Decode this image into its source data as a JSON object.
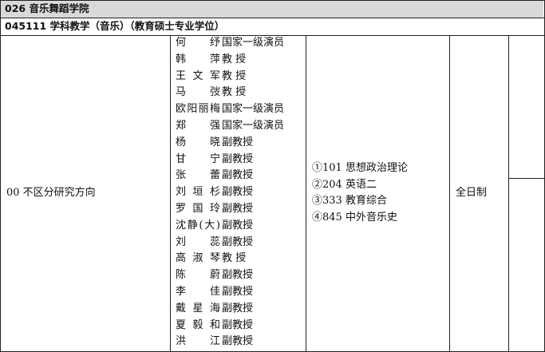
{
  "department": {
    "title": "026 音乐舞蹈学院"
  },
  "program": {
    "title": "045111 学科教学（音乐）（教育硕士专业学位）"
  },
  "row": {
    "direction": "00 不区分研究方向",
    "study_mode": "全日制",
    "teachers": [
      {
        "name": "何 纾",
        "title": "国家一级演员"
      },
      {
        "name": "韩 萍",
        "title": "教 授"
      },
      {
        "name": "王文军",
        "title": "教 授"
      },
      {
        "name": "马 弢",
        "title": "教 授"
      },
      {
        "name": "欧阳丽梅",
        "title": "国家一级演员"
      },
      {
        "name": "郑 强",
        "title": "国家一级演员"
      },
      {
        "name": "杨 晓",
        "title": "副教授"
      },
      {
        "name": "甘 宁",
        "title": "副教授"
      },
      {
        "name": "张 蕾",
        "title": "副教授"
      },
      {
        "name": "刘垣杉",
        "title": "副教授"
      },
      {
        "name": "罗国玲",
        "title": "副教授"
      },
      {
        "name": "沈静(大)",
        "title": "副教授"
      },
      {
        "name": "刘 蕊",
        "title": "副教授"
      },
      {
        "name": "高淑琴",
        "title": "教 授"
      },
      {
        "name": "陈 蔚",
        "title": "副教授"
      },
      {
        "name": "李 佳",
        "title": "副教授"
      },
      {
        "name": "戴星海",
        "title": "副教授"
      },
      {
        "name": "夏毅和",
        "title": "副教授"
      },
      {
        "name": "洪 江",
        "title": "副教授"
      }
    ],
    "exams": [
      "①101 思想政治理论",
      "②204 英语二",
      "③333 教育综合",
      "④845 中外音乐史"
    ]
  }
}
